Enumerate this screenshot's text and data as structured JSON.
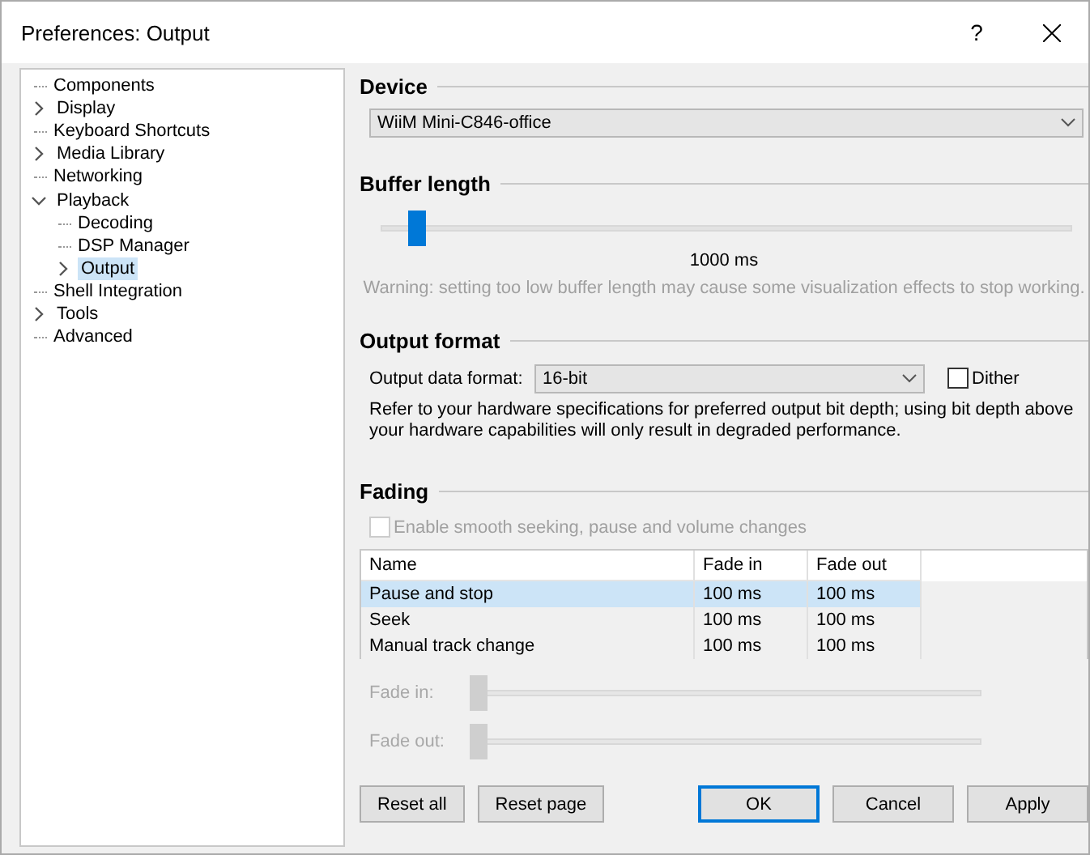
{
  "window": {
    "title": "Preferences: Output",
    "help": "?"
  },
  "tree": [
    {
      "label": "Components",
      "selected": false
    },
    {
      "label": "Display",
      "selected": false,
      "expanded": false
    },
    {
      "label": "Keyboard Shortcuts",
      "selected": false
    },
    {
      "label": "Media Library",
      "selected": false,
      "expanded": false
    },
    {
      "label": "Networking",
      "selected": false
    },
    {
      "label": "Playback",
      "selected": false,
      "expanded": true,
      "children": [
        {
          "label": "Decoding",
          "selected": false
        },
        {
          "label": "DSP Manager",
          "selected": false
        },
        {
          "label": "Output",
          "selected": true,
          "expanded": false
        }
      ]
    },
    {
      "label": "Shell Integration",
      "selected": false
    },
    {
      "label": "Tools",
      "selected": false,
      "expanded": false
    },
    {
      "label": "Advanced",
      "selected": false
    }
  ],
  "device": {
    "heading": "Device",
    "value": "WiiM Mini-C846-office"
  },
  "buffer": {
    "heading": "Buffer length",
    "level": 0.04,
    "reading": "1000 ms",
    "warning": "Warning: setting too low buffer length may cause some visualization effects to stop working."
  },
  "output_format": {
    "heading": "Output format",
    "label": "Output data format:",
    "value": "16-bit",
    "dither": {
      "label": "Dither",
      "checked": false
    },
    "note": "Refer to your hardware specifications for preferred output bit depth; using bit depth above your hardware capabilities will only result in degraded performance."
  },
  "fading": {
    "heading": "Fading",
    "enable": {
      "label": "Enable smooth seeking, pause and volume changes",
      "checked": false,
      "disabled": true
    },
    "table": {
      "columns": [
        "Name",
        "Fade in",
        "Fade out"
      ],
      "rows": [
        {
          "cells": [
            "Pause and stop",
            "100 ms",
            "100 ms"
          ],
          "selected": true
        },
        {
          "cells": [
            "Seek",
            "100 ms",
            "100 ms"
          ],
          "selected": false
        },
        {
          "cells": [
            "Manual track change",
            "100 ms",
            "100 ms"
          ],
          "selected": false
        }
      ]
    },
    "sliders": [
      {
        "label": "Fade in:",
        "level": 0,
        "disabled": true
      },
      {
        "label": "Fade out:",
        "level": 0,
        "disabled": true
      }
    ]
  },
  "buttons": [
    {
      "label": "Reset all",
      "kind": "left"
    },
    {
      "label": "Reset page",
      "kind": "left"
    },
    {
      "label": "OK",
      "kind": "default"
    },
    {
      "label": "Cancel",
      "kind": "normal"
    },
    {
      "label": "Apply",
      "kind": "normal"
    }
  ]
}
